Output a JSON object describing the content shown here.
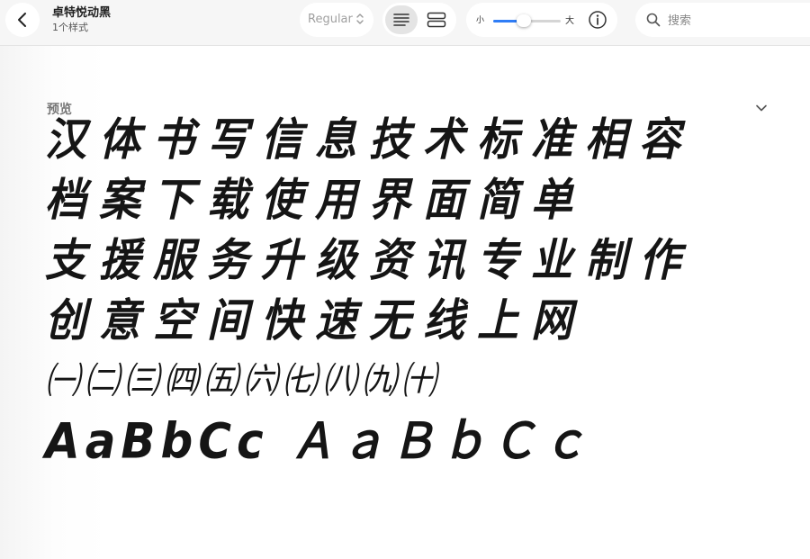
{
  "header": {
    "font_name": "卓特悦动黑",
    "style_count": "1个样式",
    "style_value": "Regular",
    "size_small_label": "小",
    "size_large_label": "大",
    "size_level_fraction": 0.45,
    "search_placeholder": "搜索",
    "accent_color": "#2f7df6"
  },
  "section": {
    "title": "预览"
  },
  "preview_lines": [
    "汉体书写信息技术标准相容",
    "档案下载使用界面简单",
    "支援服务升级资讯专业制作",
    "创意空间快速无线上网",
    "㈠㈡㈢㈣㈤㈥㈦㈧㈨㈩",
    "AaBbCc ＡａＢｂＣｃ"
  ],
  "icons": {
    "back": "chevron-left-icon",
    "style_chevron": "chevron-up-down-icon",
    "list_view": "list-view-icon",
    "grid_view": "grid-view-icon",
    "info": "info-icon",
    "search": "search-icon",
    "collapse": "chevron-down-icon"
  }
}
